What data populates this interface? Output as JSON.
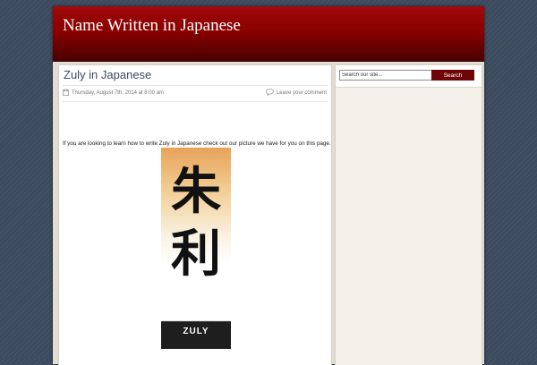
{
  "site": {
    "title": "Name Written in Japanese"
  },
  "post": {
    "title": "Zuly in Japanese",
    "date": "Thursday, August 7th, 2014 at 8:00 am",
    "comment_link": "Leave your comment",
    "intro": "If you are looking to learn how to write Zuly in Japanese check out our picture we have for you on this page.",
    "image": {
      "kanji_top": "朱",
      "kanji_bottom": "利",
      "name_label": "ZULY"
    }
  },
  "sidebar": {
    "search": {
      "placeholder": "Search our site...",
      "button_label": "Search"
    }
  },
  "colors": {
    "header_red": "#8a0000",
    "button_red": "#6e0606",
    "title_blue": "#3a4a64",
    "background": "#3c4a5e"
  }
}
